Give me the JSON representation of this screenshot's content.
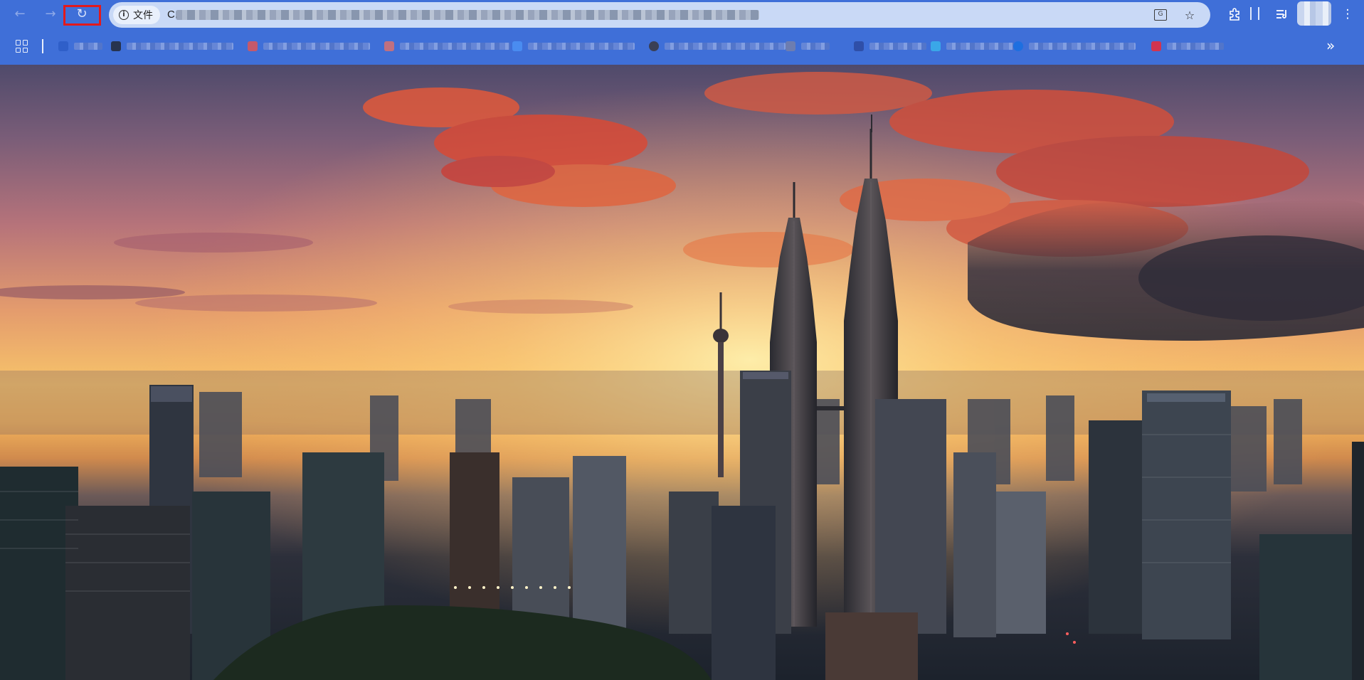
{
  "browser": {
    "nav": {
      "back_icon": "arrow-left-icon",
      "forward_icon": "arrow-right-icon",
      "reload_icon": "reload-icon"
    },
    "omnibox": {
      "site_chip_label": "文件",
      "url_visible_prefix": "C."
    },
    "toolbar_icons": [
      "translate-icon",
      "star-icon",
      "extensions-icon",
      "reading-list-icon",
      "profile-avatar",
      "menu-kebab-icon"
    ],
    "colors": {
      "chrome_blue": "#3f6fd8",
      "omnibox": "#c9d9f6",
      "highlight_red": "#e3191b"
    }
  },
  "bookmarks_bar": {
    "apps_icon": "apps-grid-icon",
    "overflow_label": "»",
    "items_count_visible": 11
  },
  "content": {
    "image_subject": "sunset-city-skyline"
  }
}
